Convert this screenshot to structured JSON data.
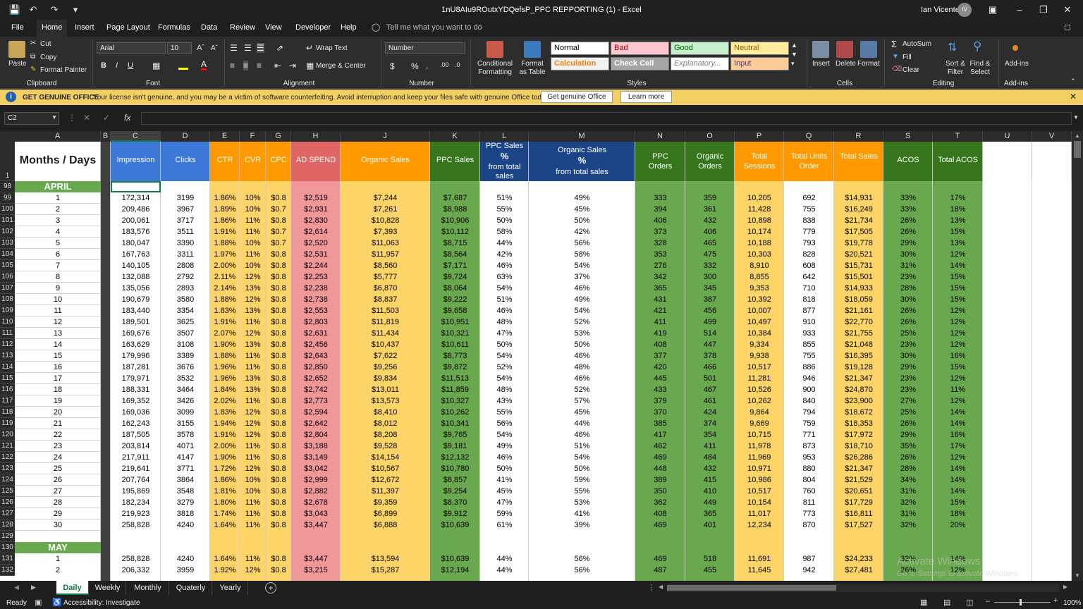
{
  "window": {
    "title": "1nU8AIu9ROutxYDQefsP_PPC REPPORTING (1)  -  Excel",
    "user": "Ian Vicente",
    "initials": "IV"
  },
  "menu": [
    "File",
    "Home",
    "Insert",
    "Page Layout",
    "Formulas",
    "Data",
    "Review",
    "View",
    "Developer",
    "Help"
  ],
  "tell_me": "Tell me what you want to do",
  "ribbon": {
    "clipboard": {
      "paste": "Paste",
      "cut": "Cut",
      "copy": "Copy",
      "format_painter": "Format Painter",
      "label": "Clipboard"
    },
    "font": {
      "name": "Arial",
      "size": "10",
      "label": "Font",
      "bold": "B",
      "italic": "I",
      "underline": "U"
    },
    "alignment": {
      "wrap": "Wrap Text",
      "merge": "Merge & Center",
      "label": "Alignment"
    },
    "number": {
      "format": "Number",
      "label": "Number",
      "currency": "$",
      "percent": "%",
      "comma": ","
    },
    "styles": {
      "conditional": "Conditional Formatting",
      "format_as": "Format as Table",
      "label": "Styles",
      "boxes": [
        {
          "t": "Normal",
          "bg": "#ffffff",
          "fg": "#000000"
        },
        {
          "t": "Bad",
          "bg": "#ffc7ce",
          "fg": "#9c0006"
        },
        {
          "t": "Good",
          "bg": "#c6efce",
          "fg": "#006100"
        },
        {
          "t": "Neutral",
          "bg": "#ffeb9c",
          "fg": "#9c5700"
        },
        {
          "t": "Calculation",
          "bg": "#f2f2f2",
          "fg": "#fa7d00"
        },
        {
          "t": "Check Cell",
          "bg": "#a5a5a5",
          "fg": "#ffffff"
        },
        {
          "t": "Explanatory...",
          "bg": "#ffffff",
          "fg": "#7f7f7f"
        },
        {
          "t": "Input",
          "bg": "#ffcc99",
          "fg": "#3f3f76"
        }
      ]
    },
    "cells": {
      "insert": "Insert",
      "delete": "Delete",
      "format": "Format",
      "label": "Cells"
    },
    "editing": {
      "autosum": "AutoSum",
      "fill": "Fill",
      "clear": "Clear",
      "sort": "Sort & Filter",
      "find": "Find & Select",
      "label": "Editing"
    },
    "addins": {
      "btn": "Add-ins",
      "label": "Add-ins"
    }
  },
  "message": {
    "title": "GET GENUINE OFFICE",
    "text": "Your license isn't genuine, and you may be a victim of software counterfeiting. Avoid interruption and keep your files safe with genuine Office today.",
    "btn1": "Get genuine Office",
    "btn2": "Learn more"
  },
  "namebox": "C2",
  "fx": "fx",
  "columns": [
    "A",
    "B",
    "C",
    "D",
    "E",
    "F",
    "G",
    "H",
    "J",
    "K",
    "L",
    "M",
    "N",
    "O",
    "P",
    "Q",
    "R",
    "S",
    "T",
    "U",
    "V"
  ],
  "headers": {
    "A": "Months / Days",
    "C": "Impression",
    "D": "Clicks",
    "E": "CTR",
    "F": "CVR",
    "G": "CPC",
    "H": "AD SPEND",
    "J": "Organic Sales",
    "K": "PPC Sales",
    "L1": "PPC Sales",
    "L2": "%",
    "L3": "from total sales",
    "M1": "Organic Sales",
    "M2": "%",
    "M3": "from total sales",
    "N": "PPC Orders",
    "O": "Organic Orders",
    "P": "Total Sessions",
    "Q": "Total Units Order",
    "R": "Total Sales",
    "S": "ACOS",
    "T": "Total  ACOS"
  },
  "months": {
    "april": "APRIL",
    "may": "MAY"
  },
  "row_numbers": {
    "header": "1",
    "april": "98",
    "blank": "129",
    "may": "130"
  },
  "april_rows": [
    [
      "99",
      "1",
      "172,314",
      "3199",
      "1.86%",
      "10%",
      "$0.8",
      "$2,519",
      "$7,244",
      "$7,687",
      "51%",
      "49%",
      "333",
      "359",
      "10,205",
      "692",
      "$14,931",
      "33%",
      "17%"
    ],
    [
      "100",
      "2",
      "209,486",
      "3967",
      "1.89%",
      "10%",
      "$0.7",
      "$2,931",
      "$7,261",
      "$8,988",
      "55%",
      "45%",
      "394",
      "361",
      "11,428",
      "755",
      "$16,249",
      "33%",
      "18%"
    ],
    [
      "101",
      "3",
      "200,061",
      "3717",
      "1.86%",
      "11%",
      "$0.8",
      "$2,830",
      "$10,828",
      "$10,906",
      "50%",
      "50%",
      "406",
      "432",
      "10,898",
      "838",
      "$21,734",
      "26%",
      "13%"
    ],
    [
      "102",
      "4",
      "183,576",
      "3511",
      "1.91%",
      "11%",
      "$0.7",
      "$2,614",
      "$7,393",
      "$10,112",
      "58%",
      "42%",
      "373",
      "406",
      "10,174",
      "779",
      "$17,505",
      "26%",
      "15%"
    ],
    [
      "103",
      "5",
      "180,047",
      "3390",
      "1.88%",
      "10%",
      "$0.7",
      "$2,520",
      "$11,063",
      "$8,715",
      "44%",
      "56%",
      "328",
      "465",
      "10,188",
      "793",
      "$19,778",
      "29%",
      "13%"
    ],
    [
      "104",
      "6",
      "167,763",
      "3311",
      "1.97%",
      "11%",
      "$0.8",
      "$2,531",
      "$11,957",
      "$8,564",
      "42%",
      "58%",
      "353",
      "475",
      "10,303",
      "828",
      "$20,521",
      "30%",
      "12%"
    ],
    [
      "105",
      "7",
      "140,105",
      "2808",
      "2.00%",
      "10%",
      "$0.8",
      "$2,244",
      "$8,560",
      "$7,171",
      "46%",
      "54%",
      "276",
      "332",
      "8,910",
      "608",
      "$15,731",
      "31%",
      "14%"
    ],
    [
      "106",
      "8",
      "132,088",
      "2792",
      "2.11%",
      "12%",
      "$0.8",
      "$2,253",
      "$5,777",
      "$9,724",
      "63%",
      "37%",
      "342",
      "300",
      "8,855",
      "642",
      "$15,501",
      "23%",
      "15%"
    ],
    [
      "107",
      "9",
      "135,056",
      "2893",
      "2.14%",
      "13%",
      "$0.8",
      "$2,238",
      "$6,870",
      "$8,064",
      "54%",
      "46%",
      "365",
      "345",
      "9,353",
      "710",
      "$14,933",
      "28%",
      "15%"
    ],
    [
      "108",
      "10",
      "190,679",
      "3580",
      "1.88%",
      "12%",
      "$0.8",
      "$2,738",
      "$8,837",
      "$9,222",
      "51%",
      "49%",
      "431",
      "387",
      "10,392",
      "818",
      "$18,059",
      "30%",
      "15%"
    ],
    [
      "109",
      "11",
      "183,440",
      "3354",
      "1.83%",
      "13%",
      "$0.8",
      "$2,553",
      "$11,503",
      "$9,658",
      "46%",
      "54%",
      "421",
      "456",
      "10,007",
      "877",
      "$21,161",
      "26%",
      "12%"
    ],
    [
      "110",
      "12",
      "189,501",
      "3625",
      "1.91%",
      "11%",
      "$0.8",
      "$2,803",
      "$11,819",
      "$10,951",
      "48%",
      "52%",
      "411",
      "499",
      "10,497",
      "910",
      "$22,770",
      "26%",
      "12%"
    ],
    [
      "111",
      "13",
      "169,676",
      "3507",
      "2.07%",
      "12%",
      "$0.8",
      "$2,631",
      "$11,434",
      "$10,321",
      "47%",
      "53%",
      "419",
      "514",
      "10,384",
      "933",
      "$21,755",
      "25%",
      "12%"
    ],
    [
      "112",
      "14",
      "163,629",
      "3108",
      "1.90%",
      "13%",
      "$0.8",
      "$2,456",
      "$10,437",
      "$10,611",
      "50%",
      "50%",
      "408",
      "447",
      "9,334",
      "855",
      "$21,048",
      "23%",
      "12%"
    ],
    [
      "113",
      "15",
      "179,996",
      "3389",
      "1.88%",
      "11%",
      "$0.8",
      "$2,643",
      "$7,622",
      "$8,773",
      "54%",
      "46%",
      "377",
      "378",
      "9,938",
      "755",
      "$16,395",
      "30%",
      "16%"
    ],
    [
      "114",
      "16",
      "187,281",
      "3676",
      "1.96%",
      "11%",
      "$0.8",
      "$2,850",
      "$9,256",
      "$9,872",
      "52%",
      "48%",
      "420",
      "466",
      "10,517",
      "886",
      "$19,128",
      "29%",
      "15%"
    ],
    [
      "115",
      "17",
      "179,971",
      "3532",
      "1.96%",
      "13%",
      "$0.8",
      "$2,652",
      "$9,834",
      "$11,513",
      "54%",
      "46%",
      "445",
      "501",
      "11,281",
      "946",
      "$21,347",
      "23%",
      "12%"
    ],
    [
      "116",
      "18",
      "188,331",
      "3464",
      "1.84%",
      "13%",
      "$0.8",
      "$2,742",
      "$13,011",
      "$11,859",
      "48%",
      "52%",
      "433",
      "467",
      "10,526",
      "900",
      "$24,870",
      "23%",
      "11%"
    ],
    [
      "117",
      "19",
      "169,352",
      "3426",
      "2.02%",
      "11%",
      "$0.8",
      "$2,773",
      "$13,573",
      "$10,327",
      "43%",
      "57%",
      "379",
      "461",
      "10,262",
      "840",
      "$23,900",
      "27%",
      "12%"
    ],
    [
      "118",
      "20",
      "169,036",
      "3099",
      "1.83%",
      "12%",
      "$0.8",
      "$2,594",
      "$8,410",
      "$10,262",
      "55%",
      "45%",
      "370",
      "424",
      "9,864",
      "794",
      "$18,672",
      "25%",
      "14%"
    ],
    [
      "119",
      "21",
      "162,243",
      "3155",
      "1.94%",
      "12%",
      "$0.8",
      "$2,642",
      "$8,012",
      "$10,341",
      "56%",
      "44%",
      "385",
      "374",
      "9,669",
      "759",
      "$18,353",
      "26%",
      "14%"
    ],
    [
      "120",
      "22",
      "187,505",
      "3578",
      "1.91%",
      "12%",
      "$0.8",
      "$2,804",
      "$8,208",
      "$9,765",
      "54%",
      "46%",
      "417",
      "354",
      "10,715",
      "771",
      "$17,972",
      "29%",
      "16%"
    ],
    [
      "121",
      "23",
      "203,814",
      "4071",
      "2.00%",
      "11%",
      "$0.8",
      "$3,188",
      "$9,528",
      "$9,181",
      "49%",
      "51%",
      "462",
      "411",
      "11,978",
      "873",
      "$18,710",
      "35%",
      "17%"
    ],
    [
      "122",
      "24",
      "217,911",
      "4147",
      "1.90%",
      "11%",
      "$0.8",
      "$3,149",
      "$14,154",
      "$12,132",
      "46%",
      "54%",
      "469",
      "484",
      "11,969",
      "953",
      "$26,286",
      "26%",
      "12%"
    ],
    [
      "123",
      "25",
      "219,641",
      "3771",
      "1.72%",
      "12%",
      "$0.8",
      "$3,042",
      "$10,567",
      "$10,780",
      "50%",
      "50%",
      "448",
      "432",
      "10,971",
      "880",
      "$21,347",
      "28%",
      "14%"
    ],
    [
      "124",
      "26",
      "207,764",
      "3864",
      "1.86%",
      "10%",
      "$0.8",
      "$2,999",
      "$12,672",
      "$8,857",
      "41%",
      "59%",
      "389",
      "415",
      "10,986",
      "804",
      "$21,529",
      "34%",
      "14%"
    ],
    [
      "125",
      "27",
      "195,869",
      "3548",
      "1.81%",
      "10%",
      "$0.8",
      "$2,882",
      "$11,397",
      "$9,254",
      "45%",
      "55%",
      "350",
      "410",
      "10,517",
      "760",
      "$20,651",
      "31%",
      "14%"
    ],
    [
      "126",
      "28",
      "182,234",
      "3279",
      "1.80%",
      "11%",
      "$0.8",
      "$2,678",
      "$9,359",
      "$8,370",
      "47%",
      "53%",
      "362",
      "449",
      "10,154",
      "811",
      "$17,729",
      "32%",
      "15%"
    ],
    [
      "127",
      "29",
      "219,923",
      "3818",
      "1.74%",
      "11%",
      "$0.8",
      "$3,043",
      "$6,899",
      "$9,912",
      "59%",
      "41%",
      "408",
      "365",
      "11,017",
      "773",
      "$16,811",
      "31%",
      "18%"
    ],
    [
      "128",
      "30",
      "258,828",
      "4240",
      "1.64%",
      "11%",
      "$0.8",
      "$3,447",
      "$6,888",
      "$10,639",
      "61%",
      "39%",
      "469",
      "401",
      "12,234",
      "870",
      "$17,527",
      "32%",
      "20%"
    ]
  ],
  "may_rows": [
    [
      "131",
      "1",
      "258,828",
      "4240",
      "1.64%",
      "11%",
      "$0.8",
      "$3,447",
      "$13,594",
      "$10,639",
      "44%",
      "56%",
      "469",
      "518",
      "11,691",
      "987",
      "$24,233",
      "32%",
      "14%"
    ],
    [
      "132",
      "2",
      "206,332",
      "3959",
      "1.92%",
      "12%",
      "$0.8",
      "$3,215",
      "$15,287",
      "$12,194",
      "44%",
      "56%",
      "487",
      "455",
      "11,645",
      "942",
      "$27,481",
      "26%",
      "12%"
    ]
  ],
  "watermark": {
    "line1": "Activate Windows",
    "line2": "Go to Settings to activate Windows."
  },
  "sheets": [
    "Daily",
    "Weekly",
    "Monthly",
    "Quaterly",
    "Yearly"
  ],
  "active_sheet": "Daily",
  "status": {
    "ready": "Ready",
    "accessibility": "Accessibility: Investigate",
    "zoom": "100%"
  }
}
